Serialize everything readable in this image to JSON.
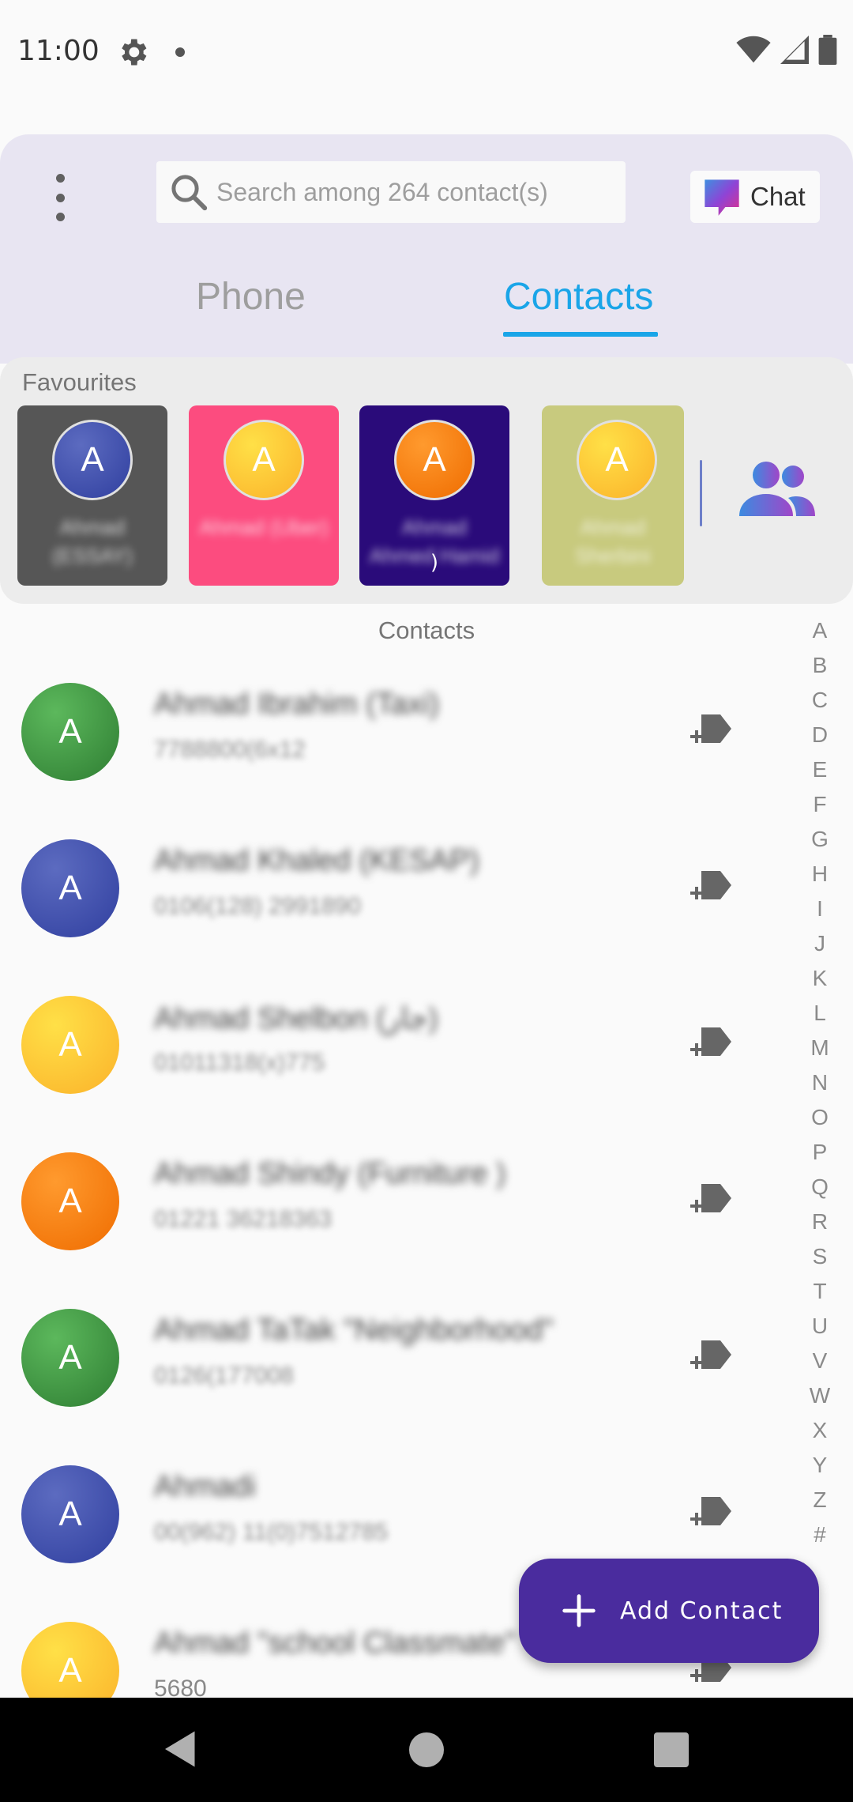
{
  "status": {
    "time": "11:00"
  },
  "header": {
    "search_placeholder": "Search among 264 contact(s)",
    "chat_label": "Chat",
    "tabs": [
      {
        "label": "Phone",
        "active": false
      },
      {
        "label": "Contacts",
        "active": true
      }
    ]
  },
  "favourites": {
    "label": "Favourites",
    "items": [
      {
        "initial": "A",
        "name": "Ahmad (ESSAY)",
        "card_color": "#565656",
        "avatar_color": "#3f51b5"
      },
      {
        "initial": "A",
        "name": "Ahmad (Uber)",
        "card_color": "#fc4c7f",
        "avatar_color": "#fdb92c"
      },
      {
        "initial": "A",
        "name": "Ahmad Ahmed Hamid",
        "card_color": "#2a0b7a",
        "avatar_color": "#f57c00",
        "loading": ")"
      },
      {
        "initial": "A",
        "name": "Ahmad Sherbini",
        "card_color": "#c8ca7e",
        "avatar_color": "#fdb92c"
      }
    ]
  },
  "contacts": {
    "section_title": "Contacts",
    "items": [
      {
        "initial": "A",
        "name": "Ahmad Ibrahim (Taxi)",
        "phone": "7788800(6x12",
        "color": "green"
      },
      {
        "initial": "A",
        "name": "Ahmad Khaled (KESAP)",
        "phone": "0106(128) 2991890",
        "color": "indigo"
      },
      {
        "initial": "A",
        "name": "Ahmad Shelbon (جار)",
        "phone": "01011318(x)775",
        "color": "yellow"
      },
      {
        "initial": "A",
        "name": "Ahmad Shindy (Furniture )",
        "phone": "01221 36218363",
        "color": "orange"
      },
      {
        "initial": "A",
        "name": "Ahmad TaTak \"Neighborhood\"",
        "phone": "0126(177008",
        "color": "green"
      },
      {
        "initial": "A",
        "name": "Ahmadi",
        "phone": "00(962) 11(0)7512785",
        "color": "indigo"
      },
      {
        "initial": "A",
        "name": "Ahmad \"school Classmate\"",
        "phone": "5680",
        "color": "yellow"
      }
    ]
  },
  "alphabet": [
    "A",
    "B",
    "C",
    "D",
    "E",
    "F",
    "G",
    "H",
    "I",
    "J",
    "K",
    "L",
    "M",
    "N",
    "O",
    "P",
    "Q",
    "R",
    "S",
    "T",
    "U",
    "V",
    "W",
    "X",
    "Y",
    "Z",
    "#"
  ],
  "fab": {
    "label": "Add Contact"
  },
  "colors": {
    "accent": "#1aa5e8",
    "fab": "#4a2c9e",
    "header_bg": "#e8e5f2"
  }
}
